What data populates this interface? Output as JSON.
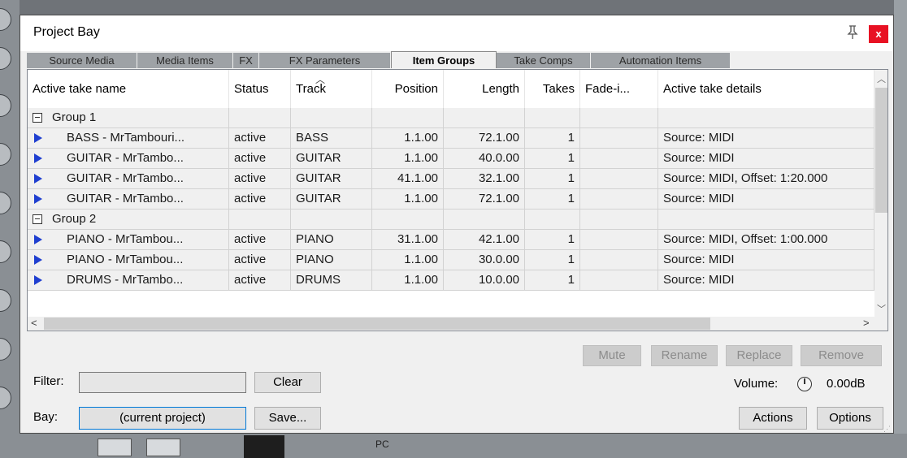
{
  "window": {
    "title": "Project Bay",
    "close_label": "x"
  },
  "tabs": [
    {
      "label": "Source Media",
      "active": false
    },
    {
      "label": "Media Items",
      "active": false
    },
    {
      "label": "FX",
      "active": false
    },
    {
      "label": "FX Parameters",
      "active": false
    },
    {
      "label": "Item Groups",
      "active": true
    },
    {
      "label": "Take Comps",
      "active": false
    },
    {
      "label": "Automation Items",
      "active": false
    }
  ],
  "columns": [
    "Active take name",
    "Status",
    "Track",
    "Position",
    "Length",
    "Takes",
    "Fade-i...",
    "Active take details"
  ],
  "rows": [
    {
      "type": "group",
      "name": "Group 1"
    },
    {
      "type": "item",
      "name": "BASS - MrTambouri...",
      "status": "active",
      "track": "BASS",
      "position": "1.1.00",
      "length": "72.1.00",
      "takes": "1",
      "fade": "",
      "details": "Source: MIDI"
    },
    {
      "type": "item",
      "name": "GUITAR - MrTambo...",
      "status": "active",
      "track": "GUITAR",
      "position": "1.1.00",
      "length": "40.0.00",
      "takes": "1",
      "fade": "",
      "details": "Source: MIDI"
    },
    {
      "type": "item",
      "name": "GUITAR - MrTambo...",
      "status": "active",
      "track": "GUITAR",
      "position": "41.1.00",
      "length": "32.1.00",
      "takes": "1",
      "fade": "",
      "details": "Source: MIDI, Offset: 1:20.000"
    },
    {
      "type": "item",
      "name": "GUITAR - MrTambo...",
      "status": "active",
      "track": "GUITAR",
      "position": "1.1.00",
      "length": "72.1.00",
      "takes": "1",
      "fade": "",
      "details": "Source: MIDI"
    },
    {
      "type": "group",
      "name": "Group 2"
    },
    {
      "type": "item",
      "name": "PIANO - MrTambou...",
      "status": "active",
      "track": "PIANO",
      "position": "31.1.00",
      "length": "42.1.00",
      "takes": "1",
      "fade": "",
      "details": "Source: MIDI, Offset: 1:00.000"
    },
    {
      "type": "item",
      "name": "PIANO - MrTambou...",
      "status": "active",
      "track": "PIANO",
      "position": "1.1.00",
      "length": "30.0.00",
      "takes": "1",
      "fade": "",
      "details": "Source: MIDI"
    },
    {
      "type": "item",
      "name": "DRUMS - MrTambo...",
      "status": "active",
      "track": "DRUMS",
      "position": "1.1.00",
      "length": "10.0.00",
      "takes": "1",
      "fade": "",
      "details": "Source: MIDI"
    }
  ],
  "actions_row": {
    "mute": "Mute",
    "rename": "Rename",
    "replace": "Replace",
    "remove": "Remove"
  },
  "filter": {
    "label": "Filter:",
    "value": "",
    "clear": "Clear"
  },
  "bay": {
    "label": "Bay:",
    "value": "(current project)",
    "save": "Save..."
  },
  "volume": {
    "label": "Volume:",
    "value": "0.00dB"
  },
  "bottom_buttons": {
    "actions": "Actions",
    "options": "Options"
  },
  "background": {
    "label": "PC"
  },
  "colors": {
    "accent": "#0078d7",
    "close": "#e81123",
    "play_icon": "#1f3fd0"
  }
}
